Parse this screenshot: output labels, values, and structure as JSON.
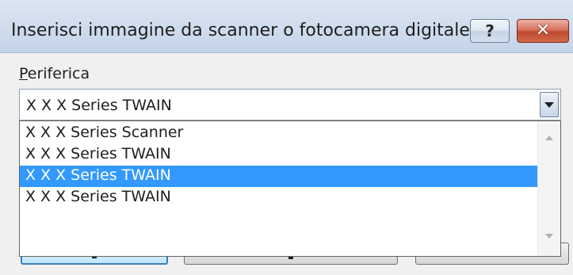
{
  "window": {
    "title": "Inserisci immagine da scanner o fotocamera digitale",
    "help_glyph": "?",
    "close_glyph": "✕"
  },
  "device": {
    "label_accesskey": "P",
    "label_rest": "eriferica",
    "selected_value": "X X X  Series TWAIN"
  },
  "dropdown": {
    "options": [
      "X X X  Series Scanner",
      "X X X  Series TWAIN",
      "X X X  Series TWAIN",
      "X X X  Series TWAIN"
    ],
    "highlighted_index": 2
  },
  "colors": {
    "selection": "#3399ff",
    "close_button": "#c14a30",
    "title_bar": "#cfdced"
  }
}
